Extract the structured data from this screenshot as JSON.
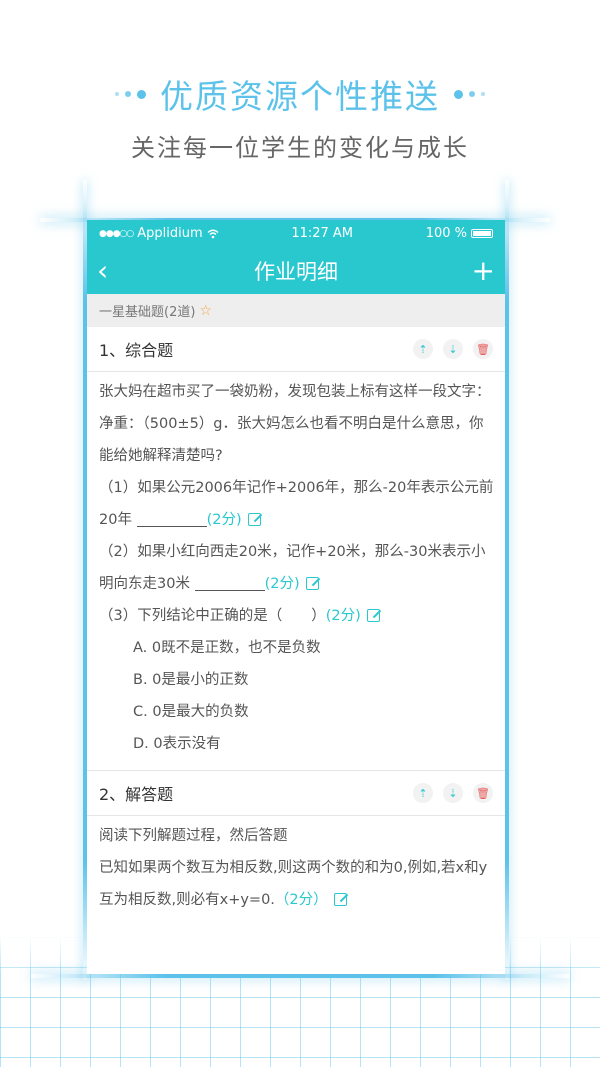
{
  "promo": {
    "title": "优质资源个性推送",
    "subtitle": "关注每一位学生的变化与成长"
  },
  "status_bar": {
    "signal": "●●●○○",
    "carrier": "Applidium",
    "wifi_icon": "wifi-icon",
    "time": "11:27 AM",
    "battery": "100 %"
  },
  "nav": {
    "back_icon": "‹",
    "title": "作业明细",
    "add_icon": "+"
  },
  "section": {
    "label": "一星基础题(2道)",
    "star_icon": "☆"
  },
  "questions": [
    {
      "title": "1、综合题",
      "lines": {
        "stem1": "张大妈在超市买了一袋奶粉，发现包装上标有这样一段文字：",
        "stem2": "净重：（500±5）g．张大妈怎么也看不明白是什么意思，你",
        "stem3": "能给她解释清楚吗?",
        "p1a": "（1）如果公元2006年记作+2006年，那么-20年表示公元前",
        "p1b": "20年",
        "p1score": "(2分)",
        "p2a": "（2）如果小红向西走20米，记作+20米，那么-30米表示小",
        "p2b": "明向东走30米",
        "p2score": "(2分)",
        "p3": "（3）下列结论中正确的是（　　）",
        "p3score": "(2分)",
        "optA": "A. 0既不是正数，也不是负数",
        "optB": "B. 0是最小的正数",
        "optC": "C. 0是最大的负数",
        "optD": "D. 0表示没有"
      }
    },
    {
      "title": "2、解答题",
      "lines": {
        "l1": "阅读下列解题过程，然后答题",
        "l2": "已知如果两个数互为相反数,则这两个数的和为0,例如,若x和y",
        "l3": "互为相反数,则必有x+y=0.",
        "score": "（2分）"
      }
    }
  ],
  "actions": {
    "move_up": "⇡",
    "move_down": "⇣",
    "delete": "🗑"
  }
}
